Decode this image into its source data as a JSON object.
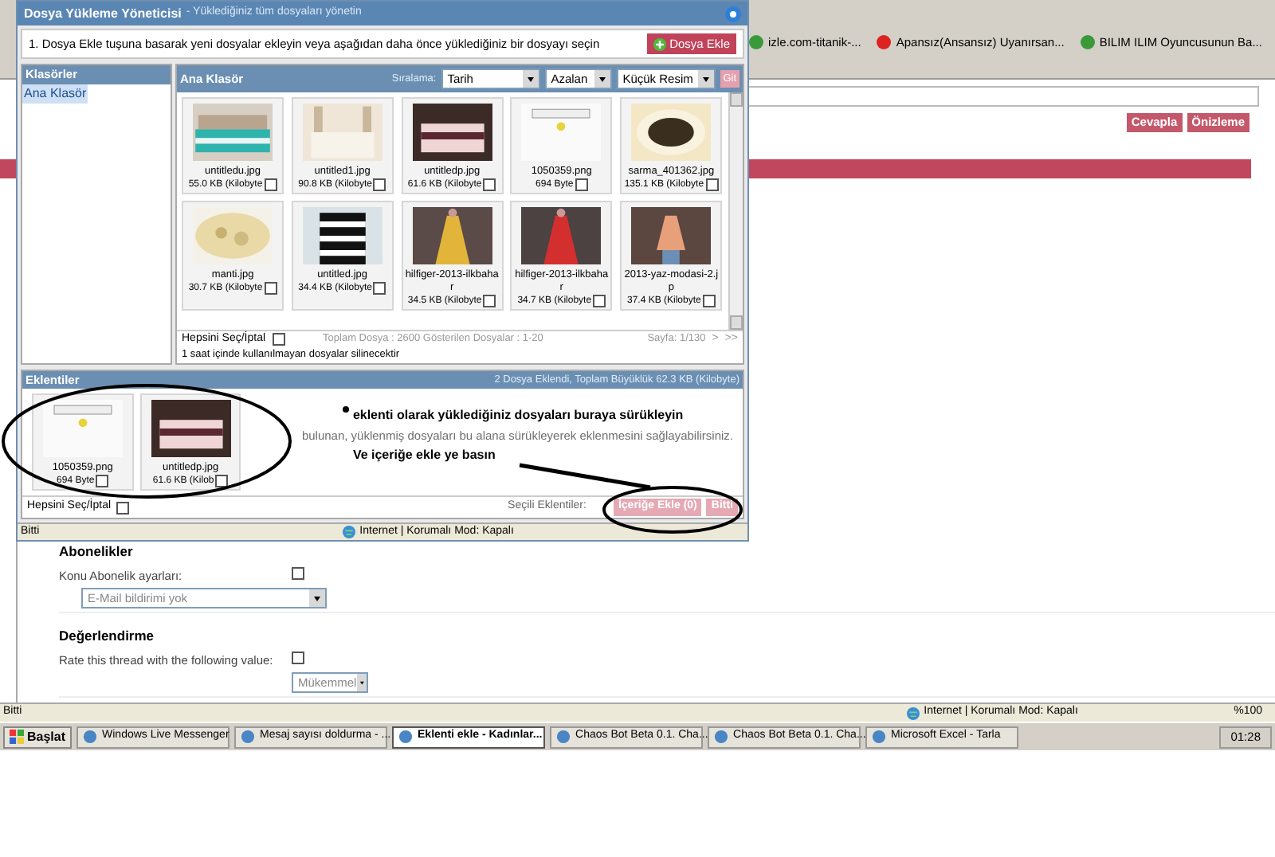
{
  "browser": {
    "bookmarks": [
      {
        "label": "izle.com-titanik-..."
      },
      {
        "label": "Apansız(Ansansız) Uyanırsan..."
      },
      {
        "label": "BILIM ILIM Oyuncusunun Ba..."
      }
    ],
    "buttons": [
      "Cevapla",
      "Önizleme"
    ]
  },
  "dialog": {
    "title": "Dosya Yükleme Yöneticisi",
    "subtitle": "- Yüklediğiniz tüm dosyaları yönetin",
    "instruction": "1. Dosya Ekle tuşuna basarak yeni dosyalar ekleyin veya aşağıdan daha önce yüklediğiniz bir dosyayı seçin",
    "add_button": "Dosya Ekle",
    "folders": {
      "title": "Klasörler",
      "items": [
        {
          "label": "Ana Klasör",
          "selected": true
        }
      ]
    },
    "browser": {
      "title": "Ana Klasör",
      "sort_label": "Sıralama:",
      "selects": [
        "Tarih",
        "Azalan",
        "Küçük Resim"
      ],
      "go_button": "Git",
      "files": [
        {
          "name": "untitledu.jpg",
          "size": "55.0 KB (Kilobyte",
          "checked": false
        },
        {
          "name": "untitled1.jpg",
          "size": "90.8 KB (Kilobyte",
          "checked": false
        },
        {
          "name": "untitledp.jpg",
          "size": "61.6 KB (Kilobyte",
          "checked": false
        },
        {
          "name": "1050359.png",
          "size": "694 Byte",
          "checked": false
        },
        {
          "name": "sarma_401362.jpg",
          "size": "135.1 KB (Kilobyte",
          "checked": false
        },
        {
          "name": "manti.jpg",
          "size": "30.7 KB (Kilobyte",
          "checked": false
        },
        {
          "name": "untitled.jpg",
          "size": "34.4 KB (Kilobyte",
          "checked": false
        },
        {
          "name": "hilfiger-2013-ilkbahar",
          "size": "34.5 KB (Kilobyte",
          "checked": false
        },
        {
          "name": "hilfiger-2013-ilkbahar",
          "size": "34.7 KB (Kilobyte",
          "checked": false
        },
        {
          "name": "2013-yaz-modasi-2.jp",
          "size": "37.4 KB (Kilobyte",
          "checked": false
        }
      ],
      "select_all": {
        "label": "Hepsini Seç/İptal",
        "checked": false
      },
      "totals": "Toplam Dosya : 2600 Gösterilen Dosyalar : 1-20",
      "page": "Sayfa: 1/130",
      "next": ">",
      "last": ">>",
      "note": "1 saat içinde kullanılmayan dosyalar silinecektir"
    },
    "attachments": {
      "title": "Eklentiler",
      "summary": "2 Dosya Eklendi, Toplam Büyüklük 62.3 KB (Kilobyte)",
      "files": [
        {
          "name": "1050359.png",
          "size": "694 Byte",
          "checked": false
        },
        {
          "name": "untitledp.jpg",
          "size": "61.6 KB (Kilob",
          "checked": false
        }
      ],
      "hint": "bulunan, yüklenmiş dosyaları bu alana sürükleyerek eklenmesini sağlayabilirsiniz.",
      "select_all": {
        "label": "Hepsini Seç/İptal",
        "checked": false
      },
      "selected_label": "Seçili Eklentiler:",
      "insert_button": "İçeriğe Ekle (0)",
      "done_button": "Bitti"
    },
    "status_bar": {
      "text": "Bitti",
      "zone": "Internet | Korumalı Mod: Kapalı"
    }
  },
  "annotations": [
    "eklenti olarak yüklediğiniz dosyaları buraya sürükleyin",
    "Ve içeriğe ekle ye basın"
  ],
  "form": {
    "sections": [
      {
        "title": "Abonelikler",
        "label": "Konu Abonelik ayarları:",
        "checked": false,
        "select": "E-Mail bildirimi yok"
      },
      {
        "title": "Değerlendirme",
        "label": "Rate this thread with the following value:",
        "checked": false,
        "select": "Mükemmel"
      }
    ]
  },
  "status_bar": {
    "text": "Bitti",
    "zone": "Internet | Korumalı Mod: Kapalı",
    "zoom": "%100"
  },
  "taskbar": {
    "start": "Başlat",
    "items": [
      {
        "label": "Windows Live Messenger",
        "selected": false
      },
      {
        "label": "Mesaj sayısı doldurma - ...",
        "selected": false
      },
      {
        "label": "Eklenti ekle - Kadınlar...",
        "selected": true
      },
      {
        "label": "Chaos Bot Beta 0.1. Cha...",
        "selected": false
      },
      {
        "label": "Chaos Bot Beta 0.1. Cha...",
        "selected": false
      },
      {
        "label": "Microsoft Excel - Tarla",
        "selected": false
      }
    ],
    "clock": "01:28"
  }
}
